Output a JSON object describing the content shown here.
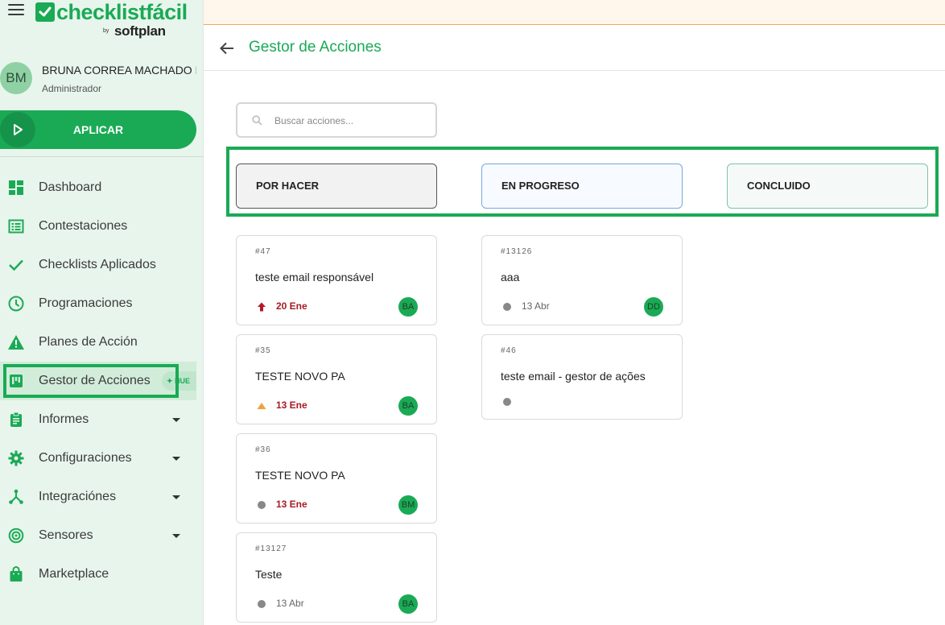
{
  "brand": {
    "logo_text": "checklistfácil",
    "by": "by",
    "company": "softplan"
  },
  "user": {
    "initials": "BM",
    "name": "BRUNA CORREA MACHADO M",
    "role": "Administrador"
  },
  "apply_button": {
    "label": "APLICAR"
  },
  "nav": {
    "dashboard": "Dashboard",
    "contestaciones": "Contestaciones",
    "checklists": "Checklists Aplicados",
    "programaciones": "Programaciones",
    "planes": "Planes de Acción",
    "gestor": "Gestor de Acciones",
    "gestor_badge": "NUE",
    "informes": "Informes",
    "configuraciones": "Configuraciones",
    "integraciones": "Integraciónes",
    "sensores": "Sensores",
    "marketplace": "Marketplace"
  },
  "page": {
    "title": "Gestor de Acciones"
  },
  "search": {
    "placeholder": "Buscar acciones..."
  },
  "columns": {
    "todo": "POR HACER",
    "progress": "EN PROGRESO",
    "done": "CONCLUIDO"
  },
  "cards": {
    "c1": {
      "id": "#47",
      "title": "teste email responsável",
      "date": "20 Ene",
      "assignee": "BA",
      "priority": "high"
    },
    "c2": {
      "id": "#35",
      "title": "TESTE NOVO PA",
      "date": "13 Ene",
      "assignee": "BA",
      "priority": "medium"
    },
    "c3": {
      "id": "#36",
      "title": "TESTE NOVO PA",
      "date": "13 Ene",
      "assignee": "BM",
      "priority": "none"
    },
    "c4": {
      "id": "#13127",
      "title": "Teste",
      "date": "13 Abr",
      "assignee": "BA",
      "priority": "none"
    },
    "c5": {
      "id": "#13126",
      "title": "aaa",
      "date": "13 Abr",
      "assignee": "DD",
      "priority": "none"
    },
    "c6": {
      "id": "#46",
      "title": "teste email - gestor de ações",
      "priority": "none"
    }
  },
  "colors": {
    "brand_green": "#1aaa55",
    "late_date": "#a61b23",
    "priority_high": "#b3192a",
    "priority_medium": "#f0a041"
  }
}
